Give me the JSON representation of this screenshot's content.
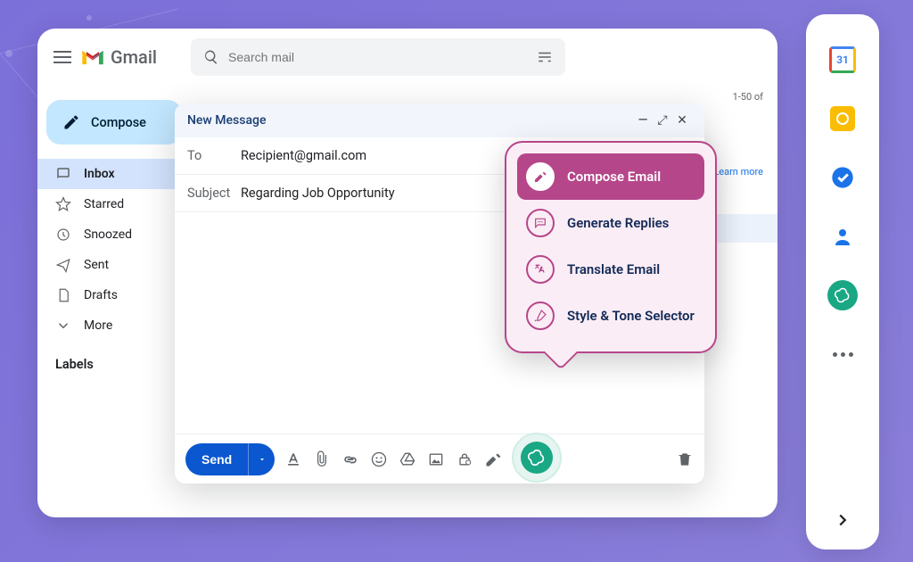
{
  "header": {
    "app_title": "Gmail",
    "search_placeholder": "Search mail",
    "pager": "1-50 of"
  },
  "sidebar": {
    "compose_label": "Compose",
    "items": [
      {
        "label": "Inbox"
      },
      {
        "label": "Starred"
      },
      {
        "label": "Snoozed"
      },
      {
        "label": "Sent"
      },
      {
        "label": "Drafts"
      },
      {
        "label": "More"
      }
    ],
    "labels_header": "Labels"
  },
  "main": {
    "learn_more": "Learn more"
  },
  "compose": {
    "title": "New Message",
    "to_label": "To",
    "to_value": "Recipient@gmail.com",
    "subject_label": "Subject",
    "subject_value": "Regarding Job Opportunity",
    "send_label": "Send"
  },
  "ai_menu": {
    "items": [
      {
        "label": "Compose Email"
      },
      {
        "label": "Generate Replies"
      },
      {
        "label": "Translate Email"
      },
      {
        "label": "Style & Tone Selector"
      }
    ]
  },
  "side_panel": {
    "calendar_day": "31"
  }
}
